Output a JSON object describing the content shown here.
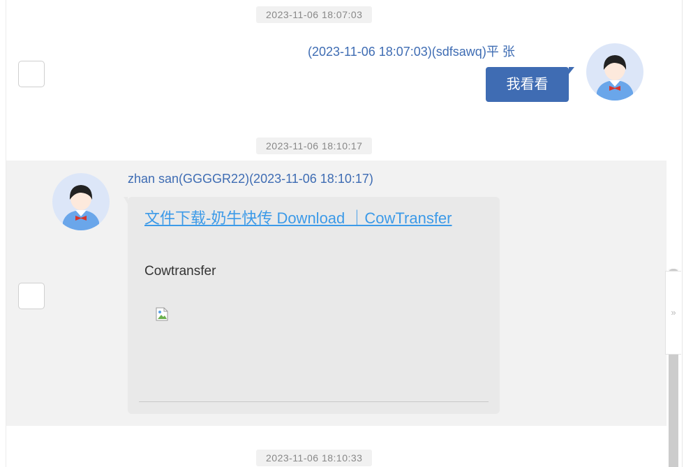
{
  "messages": [
    {
      "timestamp": "2023-11-06 18:07:03",
      "sender": "(2023-11-06 18:07:03)(sdfsawq)平 张",
      "text": "我看看",
      "direction": "outgoing"
    },
    {
      "timestamp": "2023-11-06 18:10:17",
      "sender": "zhan san(GGGGR22)(2023-11-06 18:10:17)",
      "link_text": "文件下载-奶牛快传 Download ｜CowTransfer",
      "description": "Cowtransfer",
      "direction": "incoming"
    },
    {
      "timestamp": "2023-11-06 18:10:33"
    }
  ],
  "side_panel": {
    "expand_glyph": "»"
  },
  "colors": {
    "accent": "#3f6cb3",
    "link": "#3c9ae8",
    "highlight": "#f2f2f2"
  },
  "icons": {
    "avatar": "avatar-icon",
    "broken_image": "broken-image-icon",
    "expand": "expand-panel-icon"
  }
}
